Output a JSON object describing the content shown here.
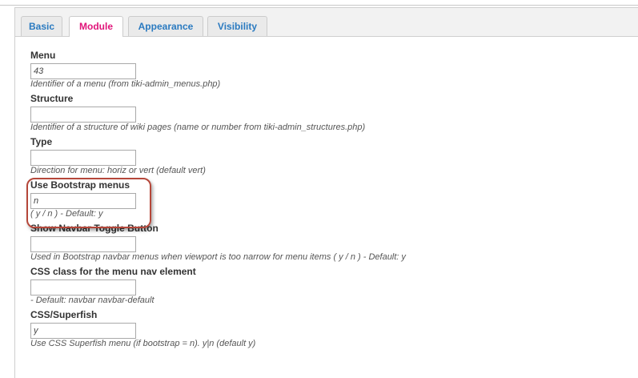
{
  "tabs": [
    {
      "label": "Basic"
    },
    {
      "label": "Module"
    },
    {
      "label": "Appearance"
    },
    {
      "label": "Visibility"
    }
  ],
  "fields": [
    {
      "label": "Menu",
      "value": "43",
      "help": "Identifier of a menu (from tiki-admin_menus.php)"
    },
    {
      "label": "Structure",
      "value": "",
      "help": "Identifier of a structure of wiki pages (name or number from tiki-admin_structures.php)"
    },
    {
      "label": "Type",
      "value": "",
      "help": "Direction for menu: horiz or vert (default vert)"
    },
    {
      "label": "Use Bootstrap menus",
      "value": "n",
      "help": "( y / n ) - Default: y"
    },
    {
      "label": "Show Navbar Toggle Button",
      "value": "",
      "help": "Used in Bootstrap navbar menus when viewport is too narrow for menu items ( y / n ) - Default: y"
    },
    {
      "label": "CSS class for the menu nav element",
      "value": "",
      "help": "- Default: navbar navbar-default"
    },
    {
      "label": "CSS/Superfish",
      "value": "y",
      "help": "Use CSS Superfish menu (if bootstrap = n). y|n (default y)"
    }
  ],
  "colors": {
    "active_tab": "#e0157a",
    "tab_link": "#2a7ac0",
    "highlight": "#b5473a"
  }
}
